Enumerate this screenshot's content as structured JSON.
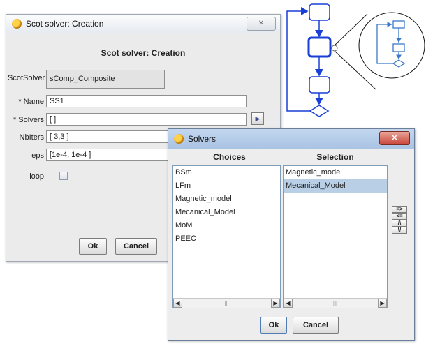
{
  "creation_dialog": {
    "title": "Scot solver: Creation",
    "heading": "Scot solver: Creation",
    "close_glyph": "✕",
    "fields": {
      "scotsolver_label": "ScotSolver",
      "scotsolver_value": "sComp_Composite",
      "name_label": "* Name",
      "name_value": "SS1",
      "solvers_label": "* Solvers",
      "solvers_value": "[ ]",
      "nbiters_label": "NbIters",
      "nbiters_value": "[ 3,3 ]",
      "eps_label": "eps",
      "eps_value": "[1e-4, 1e-4 ]",
      "loop_label": "loop"
    },
    "solvers_browse_glyph": "▶",
    "ok_label": "Ok",
    "cancel_label": "Cancel"
  },
  "solvers_dialog": {
    "title": "Solvers",
    "close_glyph": "✕",
    "choices_header": "Choices",
    "selection_header": "Selection",
    "choices": [
      "BSm",
      "LFm",
      "Magnetic_model",
      "Mecanical_Model",
      "MoM",
      "PEEC"
    ],
    "selection": [
      "Magnetic_model",
      "Mecanical_Model"
    ],
    "selected_index": 1,
    "add_label": "=>",
    "remove_label": "<=",
    "up_glyph": "/\\",
    "down_glyph": "\\/",
    "ok_label": "Ok",
    "cancel_label": "Cancel"
  },
  "colors": {
    "diagram_blue": "#1a3fd6",
    "selection_bg": "#b8cfe5",
    "close_red": "#c9453b"
  }
}
